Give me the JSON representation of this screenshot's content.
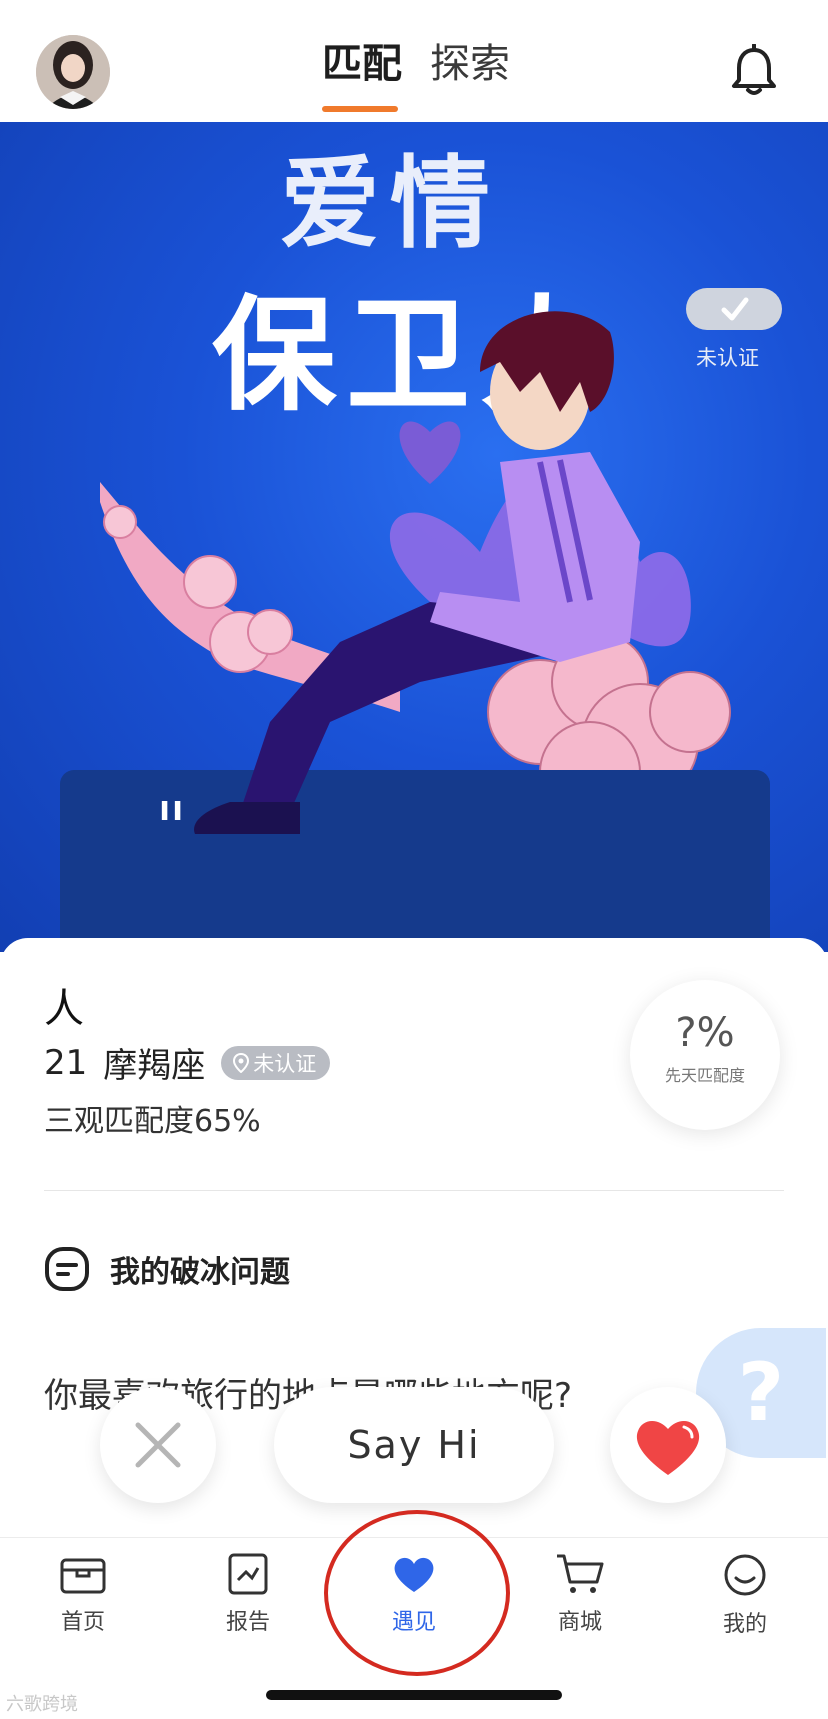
{
  "header": {
    "tabs": [
      {
        "label": "匹配",
        "active": true
      },
      {
        "label": "探索",
        "active": false
      }
    ]
  },
  "hero": {
    "title_line1": "爱情",
    "title_line2": "保卫人",
    "verify_label": "未认证"
  },
  "profile": {
    "name": "人",
    "age": "21",
    "zodiac": "摩羯座",
    "location_badge": "未认证",
    "values_match": "三观匹配度65%",
    "innate_match_value": "?%",
    "innate_match_label": "先天匹配度",
    "icebreaker_title": "我的破冰问题",
    "icebreaker_question": "你最喜欢旅行的地点是哪些地方呢?",
    "question_bubble": "?"
  },
  "actions": {
    "say_hi": "Say Hi"
  },
  "tabbar": {
    "items": [
      {
        "label": "首页",
        "icon": "home-icon"
      },
      {
        "label": "报告",
        "icon": "report-icon"
      },
      {
        "label": "遇见",
        "icon": "heart-icon",
        "active": true
      },
      {
        "label": "商城",
        "icon": "cart-icon"
      },
      {
        "label": "我的",
        "icon": "profile-icon"
      }
    ]
  },
  "colors": {
    "accent_orange": "#f07a2c",
    "active_blue": "#2f66e8",
    "like_red": "#f04545",
    "annotation_red": "#d42a20"
  },
  "watermark": "六歌跨境"
}
